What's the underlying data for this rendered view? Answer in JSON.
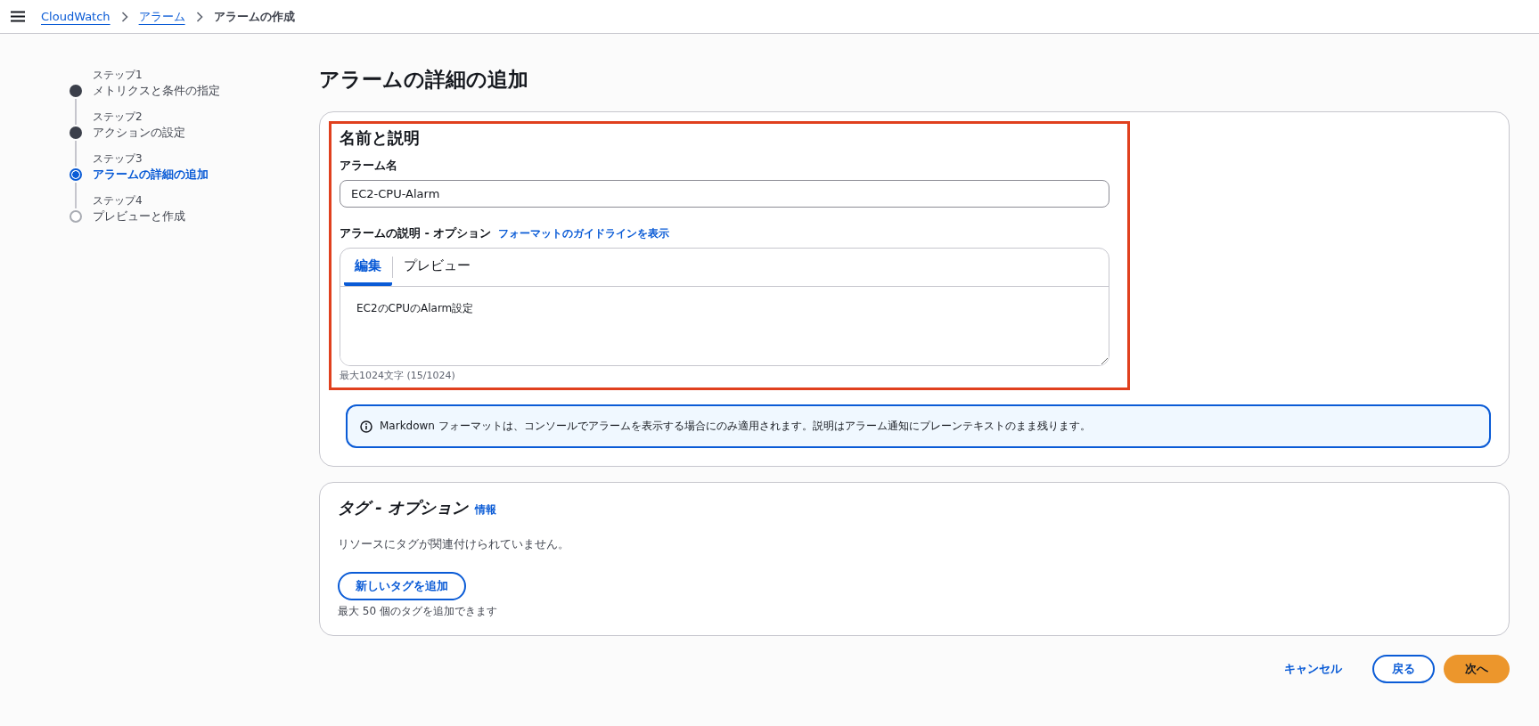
{
  "breadcrumb": [
    {
      "label": "CloudWatch",
      "kind": "link"
    },
    {
      "label": "アラーム",
      "kind": "link"
    },
    {
      "label": "アラームの作成",
      "kind": "current"
    }
  ],
  "steps": [
    {
      "step": "ステップ1",
      "title": "メトリクスと条件の指定",
      "completed": true,
      "selected": false
    },
    {
      "step": "ステップ2",
      "title": "アクションの設定",
      "completed": true,
      "selected": false
    },
    {
      "step": "ステップ3",
      "title": "アラームの詳細の追加",
      "completed": false,
      "selected": true
    },
    {
      "step": "ステップ4",
      "title": "プレビューと作成",
      "completed": false,
      "selected": false
    }
  ],
  "page_title": "アラームの詳細の追加",
  "name_section": {
    "title": "名前と説明",
    "name_label": "アラーム名",
    "name_value": "EC2-CPU-Alarm",
    "description_label": "アラームの説明 - オプション",
    "guideline_link": "フォーマットのガイドラインを表示",
    "tabs": [
      {
        "label": "編集",
        "selected": true
      },
      {
        "label": "プレビュー",
        "selected": false
      }
    ],
    "description_value": "EC2のCPUのAlarm設定",
    "char_count": "最大1024文字 (15/1024)",
    "info": "Markdown フォーマットは、コンソールでアラームを表示する場合にのみ適用されます。説明はアラーム通知にプレーンテキストのまま残ります。"
  },
  "tags_section": {
    "title": "タグ - オプション",
    "info_link": "情報",
    "empty_text": "リソースにタグが関連付けられていません。",
    "add_button": "新しいタグを追加",
    "hint": "最大 50 個のタグを追加できます"
  },
  "footer": {
    "cancel": "キャンセル",
    "back": "戻る",
    "next": "次へ"
  }
}
